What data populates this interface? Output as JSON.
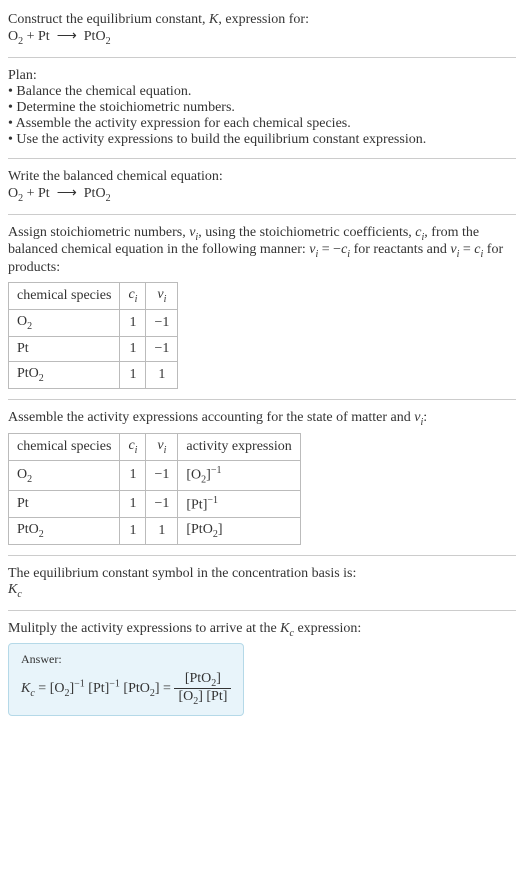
{
  "header": {
    "line1": "Construct the equilibrium constant, ",
    "kvar": "K",
    "line1b": ", expression for:",
    "equation_html": "O<sub>2</sub> + Pt &nbsp;⟶&nbsp; PtO<sub>2</sub>"
  },
  "plan": {
    "title": "Plan:",
    "items": [
      "Balance the chemical equation.",
      "Determine the stoichiometric numbers.",
      "Assemble the activity expression for each chemical species.",
      "Use the activity expressions to build the equilibrium constant expression."
    ]
  },
  "balanced": {
    "title": "Write the balanced chemical equation:",
    "equation_html": "O<sub>2</sub> + Pt &nbsp;⟶&nbsp; PtO<sub>2</sub>"
  },
  "stoich": {
    "intro_html": "Assign stoichiometric numbers, <span class='math'>ν<sub>i</sub></span>, using the stoichiometric coefficients, <span class='math'>c<sub>i</sub></span>, from the balanced chemical equation in the following manner: <span class='math'>ν<sub>i</sub></span> = −<span class='math'>c<sub>i</sub></span> for reactants and <span class='math'>ν<sub>i</sub></span> = <span class='math'>c<sub>i</sub></span> for products:",
    "headers": {
      "species": "chemical species",
      "c_html": "<span class='math'>c<sub>i</sub></span>",
      "v_html": "<span class='math'>ν<sub>i</sub></span>"
    },
    "rows": [
      {
        "species_html": "O<sub>2</sub>",
        "c": "1",
        "v": "−1"
      },
      {
        "species_html": "Pt",
        "c": "1",
        "v": "−1"
      },
      {
        "species_html": "PtO<sub>2</sub>",
        "c": "1",
        "v": "1"
      }
    ]
  },
  "activity": {
    "intro_html": "Assemble the activity expressions accounting for the state of matter and <span class='math'>ν<sub>i</sub></span>:",
    "headers": {
      "species": "chemical species",
      "c_html": "<span class='math'>c<sub>i</sub></span>",
      "v_html": "<span class='math'>ν<sub>i</sub></span>",
      "activity": "activity expression"
    },
    "rows": [
      {
        "species_html": "O<sub>2</sub>",
        "c": "1",
        "v": "−1",
        "act_html": "[O<sub>2</sub>]<sup>−1</sup>"
      },
      {
        "species_html": "Pt",
        "c": "1",
        "v": "−1",
        "act_html": "[Pt]<sup>−1</sup>"
      },
      {
        "species_html": "PtO<sub>2</sub>",
        "c": "1",
        "v": "1",
        "act_html": "[PtO<sub>2</sub>]"
      }
    ]
  },
  "kc_symbol": {
    "title": "The equilibrium constant symbol in the concentration basis is:",
    "symbol_html": "<span class='math'>K<sub>c</sub></span>"
  },
  "multiply": {
    "title_html": "Mulitply the activity expressions to arrive at the <span class='math'>K<sub>c</sub></span> expression:"
  },
  "answer": {
    "label": "Answer:",
    "lhs_html": "<span class='math'>K<sub>c</sub></span> = [O<sub>2</sub>]<sup>−1</sup> [Pt]<sup>−1</sup> [PtO<sub>2</sub>] = ",
    "num_html": "[PtO<sub>2</sub>]",
    "den_html": "[O<sub>2</sub>] [Pt]"
  }
}
